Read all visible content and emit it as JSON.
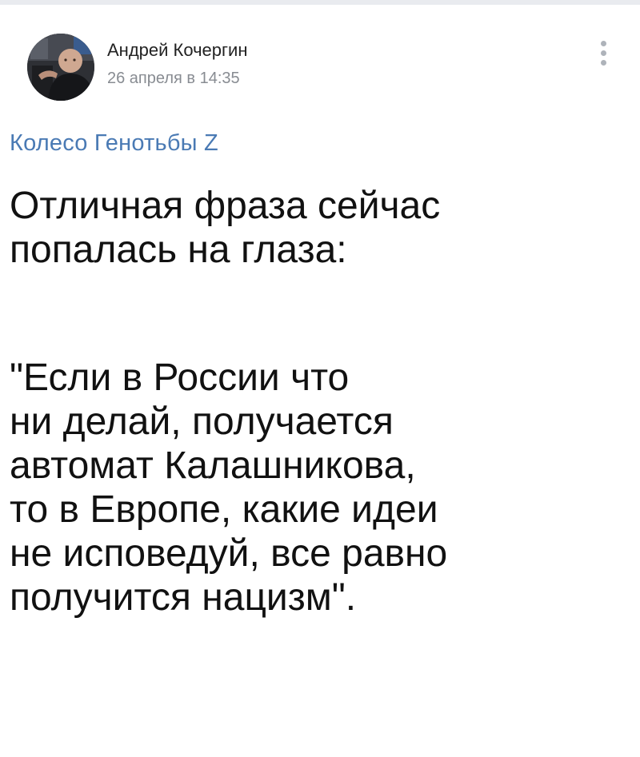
{
  "post": {
    "author": {
      "name": "Андрей Кочергин",
      "avatar_icon": "user-photo-avatar"
    },
    "timestamp": "26 апреля в 14:35",
    "menu_icon": "vertical-dots-icon",
    "source_title": "Колесо Генотьбы Z",
    "text": {
      "paragraph_1": [
        "Отличная фраза сейчас",
        "попалась на глаза:"
      ],
      "paragraph_2": [
        "\"Если в России что",
        "ни делай, получается",
        "автомат Калашникова,",
        "то в Европе, какие идеи",
        "не исповедуй, все равно",
        "получится нацизм\"."
      ]
    }
  },
  "colors": {
    "link": "#4a7ab4",
    "text": "#111111",
    "meta": "#888c92",
    "top_strip": "#e9ebef"
  }
}
